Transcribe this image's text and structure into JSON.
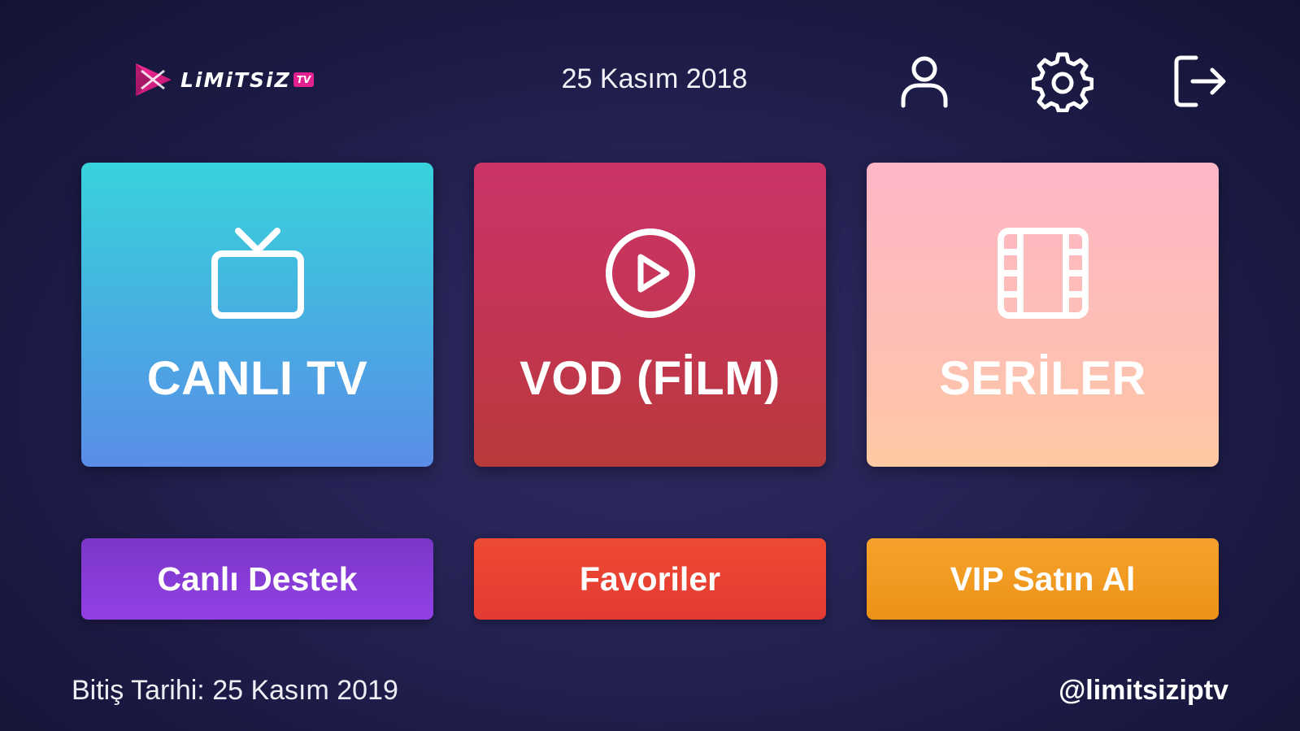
{
  "header": {
    "logo_text": "LiMiTSiZ",
    "logo_badge": "TV",
    "date": "25 Kasım 2018",
    "icons": [
      "user-icon",
      "gear-icon",
      "logout-icon"
    ]
  },
  "tiles": [
    {
      "label": "CANLI TV",
      "icon": "tv-icon",
      "color_top": "#38d3dc",
      "color_bottom": "#5a8de8"
    },
    {
      "label": "VOD (FİLM)",
      "icon": "play-circle-icon",
      "color_top": "#cc3468",
      "color_bottom": "#b83b3a"
    },
    {
      "label": "SERİLER",
      "icon": "film-strip-icon",
      "color_top": "#fdb6c6",
      "color_bottom": "#fec9a3"
    }
  ],
  "buttons": [
    {
      "label": "Canlı Destek",
      "color": "#8a3ddb"
    },
    {
      "label": "Favoriler",
      "color": "#e8432f"
    },
    {
      "label": "VIP Satın Al",
      "color": "#f29a20"
    }
  ],
  "footer": {
    "expiry": "Bitiş Tarihi: 25 Kasım 2019",
    "handle": "@limitsiziptv"
  }
}
